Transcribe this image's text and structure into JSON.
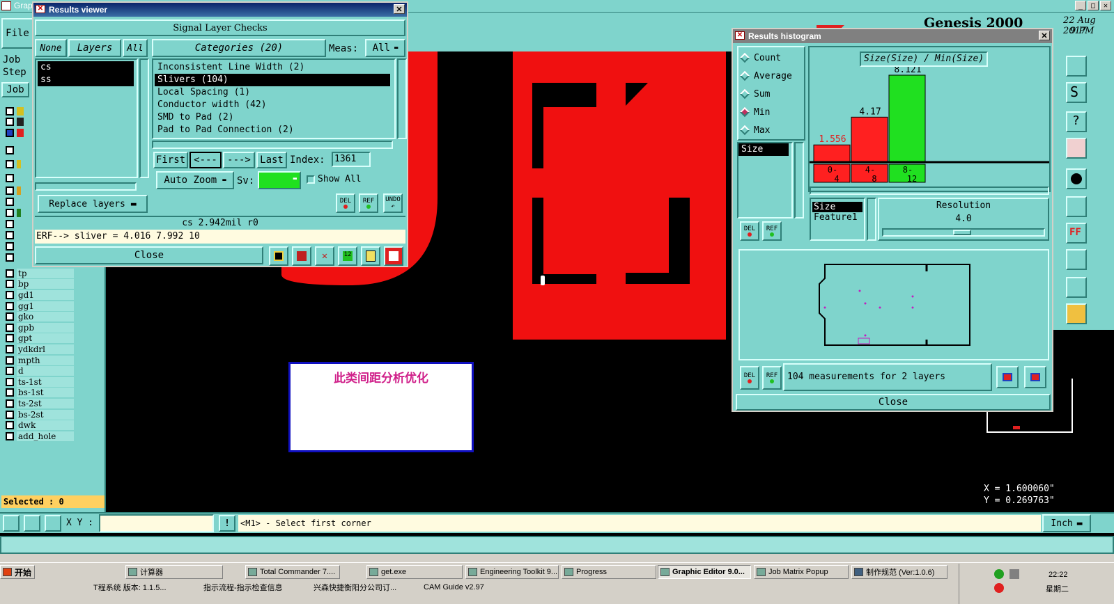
{
  "main_window": {
    "title": "Grap",
    "menu_file": "File",
    "job_label": "Job",
    "step_label": "Step",
    "job_btn": "Job",
    "brand": "Genesis 2000",
    "date": "22 Aug 2017",
    "time": "9 PM",
    "selected": "Selected : 0",
    "xy_label": "X Y :",
    "prompt": "<M1> - Select first corner",
    "units": "Inch",
    "coord_x": "X = 1.600060\"",
    "coord_y": "Y = 0.269763\"",
    "layers": [
      "tp",
      "bp",
      "gd1",
      "gg1",
      "gko",
      "gpb",
      "gpt",
      "ydkdrl",
      "mpth",
      "d",
      "ts-1st",
      "bs-1st",
      "ts-2st",
      "bs-2st",
      "dwk",
      "add_hole"
    ]
  },
  "annotation": {
    "text": "此类间距分析优化"
  },
  "results_viewer": {
    "title": "Results viewer",
    "header": "Signal Layer Checks",
    "none_btn": "None",
    "layers_btn": "Layers",
    "all_btn": "All",
    "categories_label": "Categories (20)",
    "meas_label": "Meas:",
    "meas_value": "All",
    "layer_items": [
      "cs",
      "ss"
    ],
    "categories": [
      "Inconsistent Line Width (2)",
      "Slivers (104)",
      "Local Spacing (1)",
      "Conductor width (42)",
      "SMD to Pad (2)",
      "Pad to Pad Connection (2)"
    ],
    "first_btn": "First",
    "prev_btn": "<---",
    "next_btn": "--->",
    "last_btn": "Last",
    "index_label": "Index:",
    "index_value": "1361",
    "auto_zoom": "Auto Zoom",
    "sv_label": "Sv:",
    "show_all": "Show All",
    "replace_layers": "Replace layers",
    "del": "DEL",
    "ref": "REF",
    "undo": "UNDO",
    "status": "cs 2.942mil  r0",
    "erf": "ERF--> sliver = 4.016 7.992 10",
    "close": "Close"
  },
  "histogram": {
    "title": "Results histogram",
    "options": [
      "Count",
      "Average",
      "Sum",
      "Min",
      "Max"
    ],
    "selected_option": "Min",
    "attr_item": "Size",
    "chart_title": "Size(Size) / Min(Size)",
    "size_label": "Size",
    "feature_label": "Feature1",
    "resolution_label": "Resolution",
    "resolution_value": "4.0",
    "summary": "104 measurements for 2 layers",
    "close": "Close",
    "del": "DEL",
    "ref": "REF"
  },
  "chart_data": {
    "type": "bar",
    "title": "Size(Size) / Min(Size)",
    "categories": [
      "0-4",
      "4-8",
      "8-12"
    ],
    "values": [
      1.556,
      4.17,
      8.121
    ],
    "value_labels": [
      "1.556",
      "4.17",
      "8.121"
    ],
    "colors": [
      "#ff2020",
      "#ff2020",
      "#20e020"
    ],
    "ylim": [
      0,
      8.121
    ]
  },
  "taskbar": {
    "start": "开始",
    "row1": [
      "计算器",
      "Total Commander 7....",
      "get.exe",
      "Engineering Toolkit 9...",
      "Progress",
      "Graphic Editor 9.0...",
      "Job Matrix Popup",
      "制作规范 (Ver:1.0.6)"
    ],
    "row2": [
      "T程系统 版本: 1.1.5...",
      "指示流程-指示检查信息",
      "兴森快捷衡阳分公司订...",
      "CAM Guide v2.97"
    ],
    "clock": "22:22",
    "weekday": "星期二"
  }
}
